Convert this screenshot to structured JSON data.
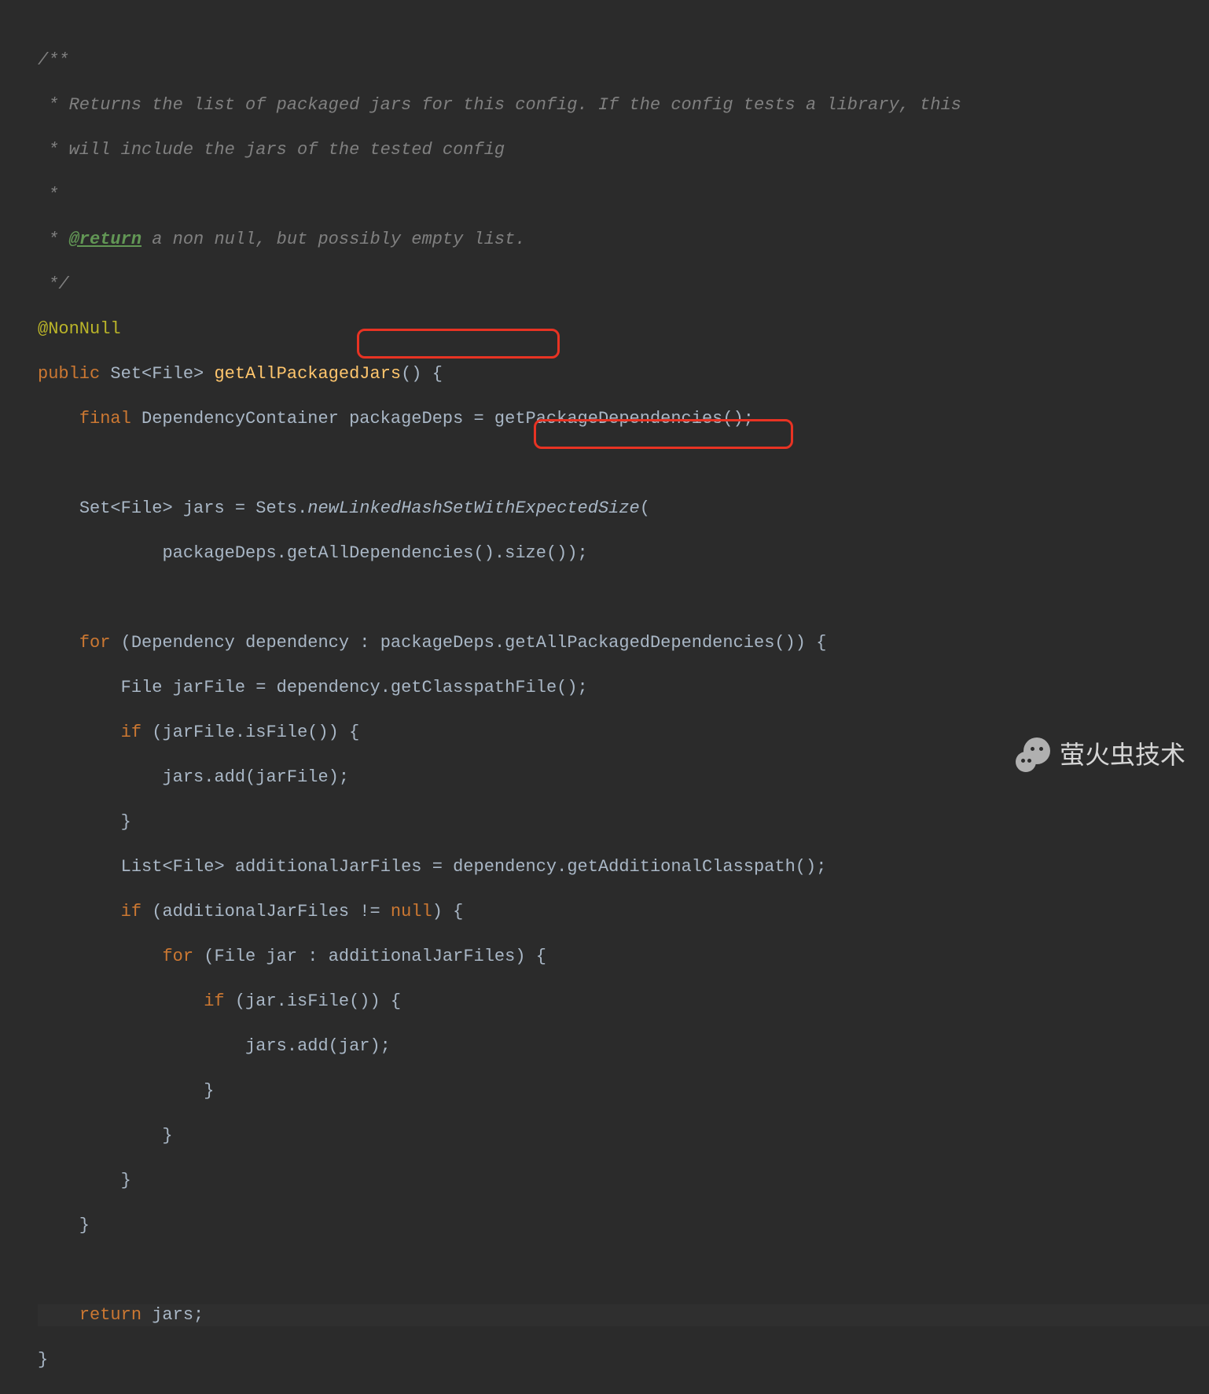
{
  "code": {
    "c1": "/**",
    "c2": " * Returns the list of packaged jars for this config. If the config tests a library, this",
    "c3": " * will include the jars of the tested config",
    "c4": " *",
    "c5_prefix": " * ",
    "c5_tag": "@return",
    "c5_rest": " a non null, but possibly empty list.",
    "c6": " */",
    "ann": "@NonNull",
    "kw_public": "public",
    "ty_set": "Set",
    "ty_file": "File",
    "ty_list": "List",
    "ty_depcont": "DependencyContainer",
    "ty_dependency": "Dependency",
    "m_getAllPackagedJars": "getAllPackagedJars",
    "kw_final": "final",
    "v_packageDeps": "packageDeps",
    "m_getPackageDependencies": "getPackageDependencies",
    "v_jars": "jars",
    "cls_Sets": "Sets",
    "m_newLinkedHashSetWithExpectedSize": "newLinkedHashSetWithExpectedSize",
    "m_getAllDependencies": "getAllDependencies",
    "m_size": "size",
    "kw_for": "for",
    "v_dependency": "dependency",
    "m_getAllPackagedDependencies": "getAllPackagedDependencies",
    "v_jarFile": "jarFile",
    "m_getClasspathFile": "getClasspathFile",
    "kw_if": "if",
    "m_isFile": "isFile",
    "m_add": "add",
    "v_additionalJarFiles": "additionalJarFiles",
    "m_getAdditionalClasspath": "getAdditionalClasspath",
    "kw_null": "null",
    "v_jar": "jar",
    "kw_return": "return"
  },
  "highlights": {
    "h1_target": ".getClasspathFile();",
    "h2_target": "getAdditionalClasspath();"
  },
  "watermark": {
    "text": "萤火虫技术"
  }
}
